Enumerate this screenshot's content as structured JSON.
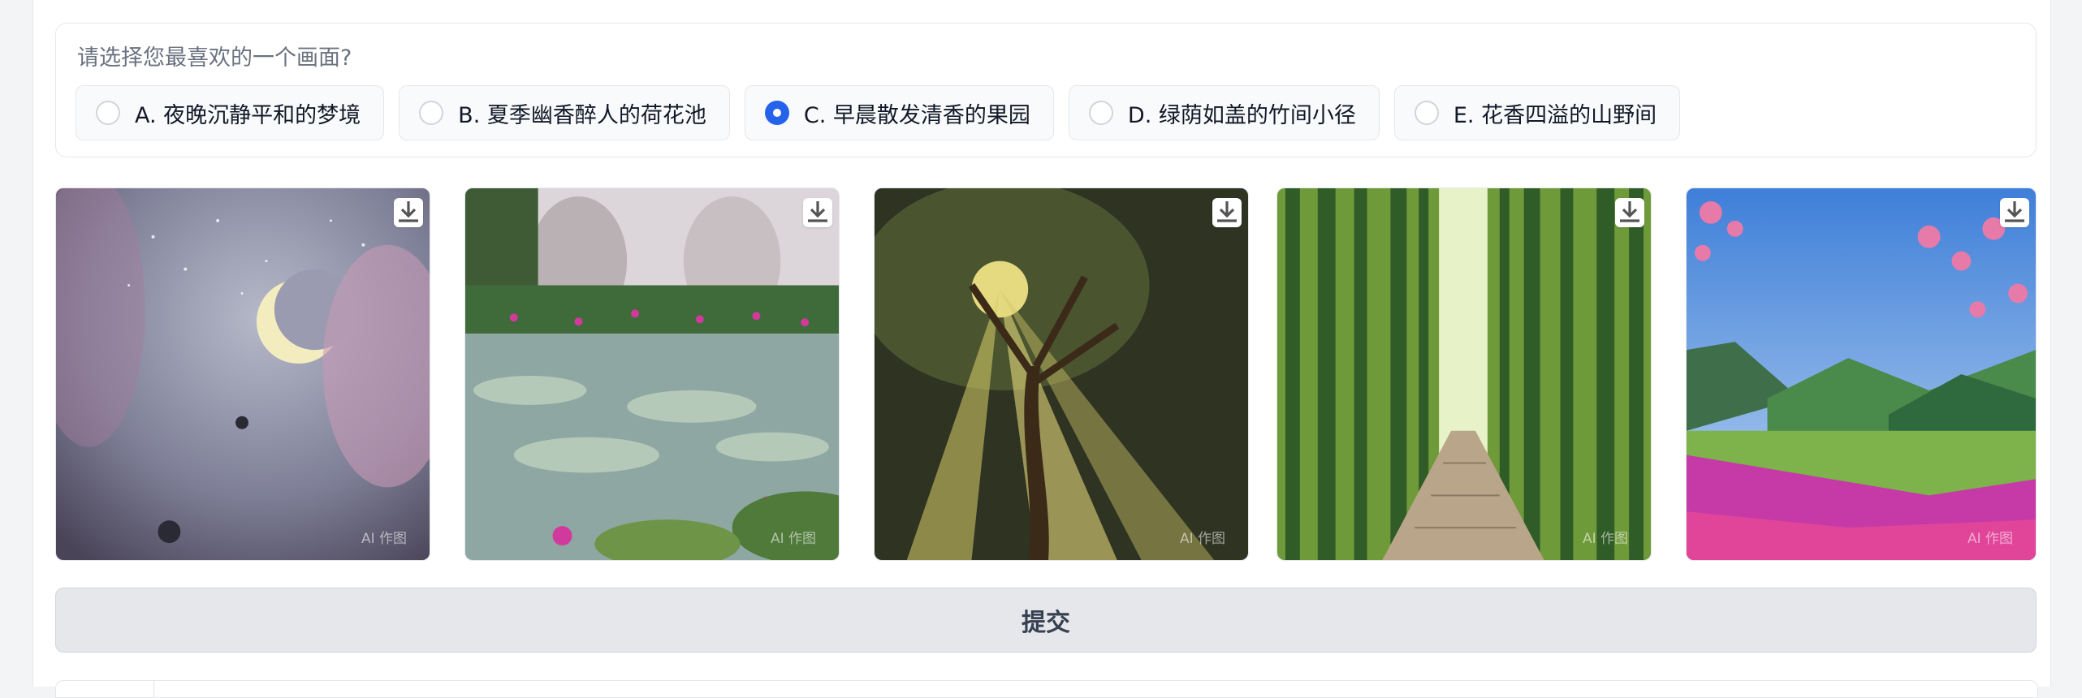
{
  "question": {
    "title": "请选择您最喜欢的一个画面?",
    "options": [
      {
        "label": "A. 夜晚沉静平和的梦境",
        "checked": false
      },
      {
        "label": "B. 夏季幽香醉人的荷花池",
        "checked": false
      },
      {
        "label": "C. 早晨散发清香的果园",
        "checked": true
      },
      {
        "label": "D. 绿荫如盖的竹间小径",
        "checked": false
      },
      {
        "label": "E. 花香四溢的山野间",
        "checked": false
      }
    ]
  },
  "gallery": {
    "watermark": "AI 作图",
    "download_icon": "download-icon",
    "images": [
      {
        "subject": "moon-night-dream"
      },
      {
        "subject": "lotus-pond"
      },
      {
        "subject": "sunlit-orchard-tree"
      },
      {
        "subject": "bamboo-path"
      },
      {
        "subject": "flower-mountains"
      }
    ]
  },
  "submit": {
    "label": "提交"
  },
  "colors": {
    "accent": "#2563eb",
    "border": "#e5e7eb",
    "button_bg": "#e5e7eb"
  }
}
